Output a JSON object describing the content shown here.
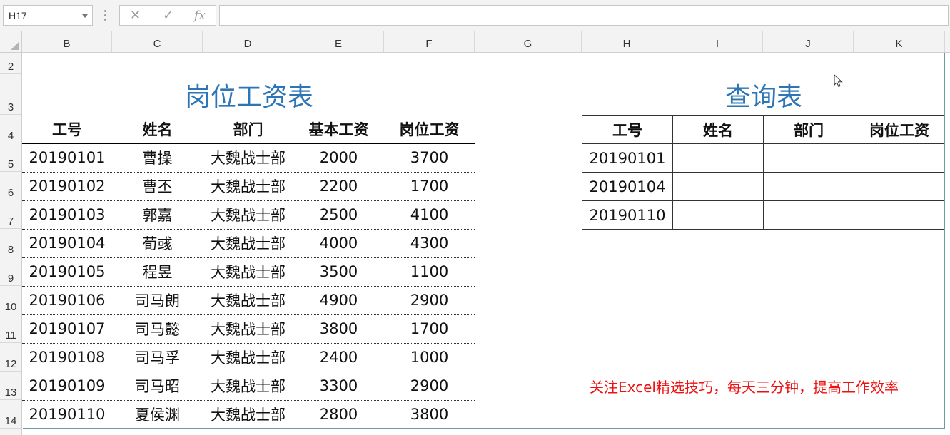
{
  "formula_bar": {
    "name_box": "H17",
    "cancel_glyph": "✕",
    "enter_glyph": "✓",
    "fx_label": "fx",
    "formula": ""
  },
  "columns": [
    "B",
    "C",
    "D",
    "E",
    "F",
    "G",
    "H",
    "I",
    "J",
    "K"
  ],
  "rows": [
    "2",
    "3",
    "4",
    "5",
    "6",
    "7",
    "8",
    "9",
    "10",
    "11",
    "12",
    "13",
    "14"
  ],
  "salary_table": {
    "title": "岗位工资表",
    "headers": [
      "工号",
      "姓名",
      "部门",
      "基本工资",
      "岗位工资"
    ],
    "rows": [
      [
        "20190101",
        "曹操",
        "大魏战士部",
        "2000",
        "3700"
      ],
      [
        "20190102",
        "曹丕",
        "大魏战士部",
        "2200",
        "1700"
      ],
      [
        "20190103",
        "郭嘉",
        "大魏战士部",
        "2500",
        "4100"
      ],
      [
        "20190104",
        "荀彧",
        "大魏战士部",
        "4000",
        "4300"
      ],
      [
        "20190105",
        "程昱",
        "大魏战士部",
        "3500",
        "1100"
      ],
      [
        "20190106",
        "司马朗",
        "大魏战士部",
        "4900",
        "2900"
      ],
      [
        "20190107",
        "司马懿",
        "大魏战士部",
        "3800",
        "1700"
      ],
      [
        "20190108",
        "司马孚",
        "大魏战士部",
        "2400",
        "1000"
      ],
      [
        "20190109",
        "司马昭",
        "大魏战士部",
        "3300",
        "2900"
      ],
      [
        "20190110",
        "夏侯渊",
        "大魏战士部",
        "2800",
        "3800"
      ]
    ]
  },
  "lookup_table": {
    "title": "查询表",
    "headers": [
      "工号",
      "姓名",
      "部门",
      "岗位工资"
    ],
    "rows": [
      [
        "20190101",
        "",
        "",
        ""
      ],
      [
        "20190104",
        "",
        "",
        ""
      ],
      [
        "20190110",
        "",
        "",
        ""
      ]
    ]
  },
  "footer_note": "关注Excel精选技巧，每天三分钟，提高工作效率",
  "colors": {
    "title": "#2e75b6",
    "note": "#ee1111",
    "header_bg": "#f3f3f3"
  },
  "icons": {
    "name_box_dropdown": "chevron-down-icon",
    "cancel": "close-icon",
    "enter": "check-icon",
    "cursor": "mouse-pointer-icon"
  }
}
